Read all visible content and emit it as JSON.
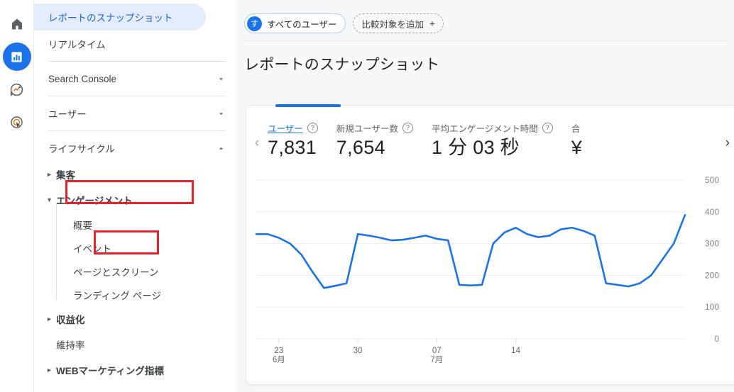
{
  "rail": {
    "items": [
      {
        "name": "home-icon",
        "label": "ホーム"
      },
      {
        "name": "reports-icon",
        "label": "レポート"
      },
      {
        "name": "explore-icon",
        "label": "探索"
      },
      {
        "name": "advertising-icon",
        "label": "広告"
      }
    ]
  },
  "sidebar": {
    "selected_item": "レポートのスナップショット",
    "items": [
      {
        "label": "レポートのスナップショット",
        "type": "item",
        "selected": true
      },
      {
        "label": "リアルタイム",
        "type": "item",
        "selected": false
      },
      {
        "label": "Search Console",
        "type": "item",
        "selected": false,
        "chevron": "chevron-down"
      },
      {
        "label": "ユーザー",
        "type": "item",
        "selected": false,
        "chevron": "chevron-down"
      },
      {
        "label": "ライフサイクル",
        "type": "item",
        "selected": false,
        "chevron": "chevron-up"
      }
    ],
    "groups": [
      {
        "label": "集客",
        "expanded": false,
        "triangle": "►"
      },
      {
        "label": "エンゲージメント",
        "expanded": true,
        "triangle": "▼",
        "highlighted": true
      },
      {
        "label": "収益化",
        "expanded": false,
        "triangle": "►"
      },
      {
        "label": "WEBマーケティング指標",
        "expanded": false,
        "triangle": "►"
      }
    ],
    "engagement_children": [
      {
        "label": "概要",
        "highlighted": false
      },
      {
        "label": "イベント",
        "highlighted": true
      },
      {
        "label": "ページとスクリーン",
        "highlighted": false
      },
      {
        "label": "ランディング ページ",
        "highlighted": false
      }
    ],
    "retention_item": {
      "label": "維持率"
    }
  },
  "main": {
    "chips": {
      "all_users": {
        "label": "すべてのユーザー",
        "avatar": "す"
      },
      "add_comparison": {
        "label": "比較対象を追加",
        "plus": "+"
      }
    },
    "page_title": "レポートのスナップショット",
    "metrics": [
      {
        "label": "ユーザー",
        "value": "7,831",
        "active": true,
        "help": "?"
      },
      {
        "label": "新規ユーザー数",
        "value": "7,654",
        "active": false,
        "help": "?"
      },
      {
        "label": "平均エンゲージメント時間",
        "value": "1 分 03 秒",
        "active": false,
        "help": "?"
      },
      {
        "label": "合",
        "value": "¥",
        "active": false,
        "partial": true
      }
    ],
    "prev_arrow": "‹",
    "next_arrow": "›",
    "status_icon": "check-circle-icon",
    "status_color": "#188038"
  },
  "colors": {
    "accent": "#1a73e8",
    "line": "#1a73e8",
    "selected_bg": "#e4ecfb",
    "selected_text": "#1967d2",
    "page_bg": "#f7f8fa",
    "annotation": "#e8212c",
    "status_green": "#188038"
  },
  "chart_data": {
    "type": "line",
    "title": "",
    "xlabel": "",
    "ylabel": "",
    "ylim": [
      0,
      500
    ],
    "yticks": [
      500,
      400,
      300,
      200,
      100,
      0
    ],
    "grid": true,
    "legend": false,
    "xticks": [
      {
        "pos": 2,
        "label": "23",
        "sublabel": "6月"
      },
      {
        "pos": 9,
        "label": "30",
        "sublabel": ""
      },
      {
        "pos": 16,
        "label": "07",
        "sublabel": "7月"
      },
      {
        "pos": 23,
        "label": "14",
        "sublabel": ""
      }
    ],
    "series": [
      {
        "name": "ユーザー",
        "color": "#1a73e8",
        "values": [
          330,
          330,
          318,
          300,
          265,
          210,
          160,
          167,
          175,
          330,
          325,
          318,
          310,
          312,
          318,
          325,
          315,
          310,
          170,
          168,
          170,
          300,
          335,
          350,
          330,
          320,
          325,
          345,
          350,
          340,
          325,
          175,
          170,
          165,
          175,
          200,
          250,
          300,
          390
        ]
      }
    ]
  }
}
